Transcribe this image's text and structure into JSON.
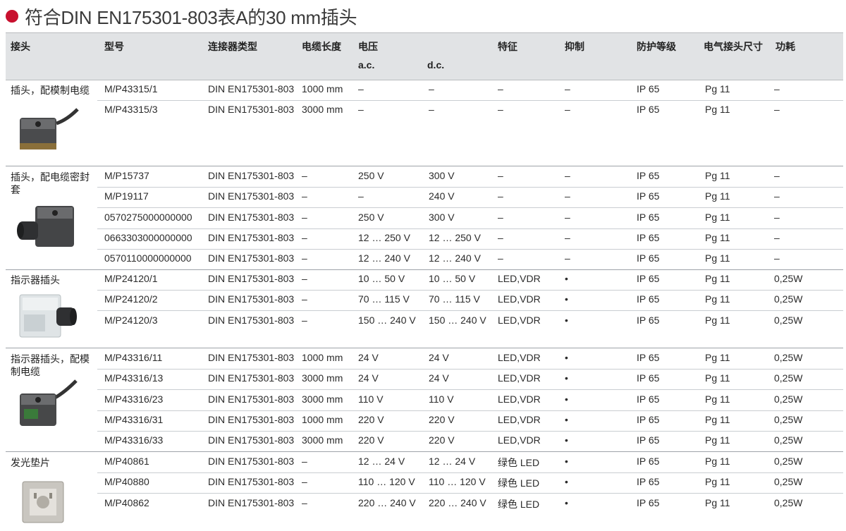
{
  "title": "符合DIN EN175301-803表A的30 mm插头",
  "accent": "#c8102e",
  "header": {
    "cols": [
      "接头",
      "型号",
      "连接器类型",
      "电缆长度",
      "电压",
      "特征",
      "抑制",
      "防护等级",
      "电气接头尺寸",
      "功耗"
    ],
    "sub": [
      "a.c.",
      "d.c."
    ]
  },
  "groups": [
    {
      "name": "插头，配模制电缆",
      "icon": "plug-with-cable-icon",
      "rows": [
        [
          "M/P43315/1",
          "DIN EN175301-803",
          "1000 mm",
          "–",
          "–",
          "–",
          "–",
          "IP 65",
          "Pg 11",
          "–"
        ],
        [
          "M/P43315/3",
          "DIN EN175301-803",
          "3000 mm",
          "–",
          "–",
          "–",
          "–",
          "IP 65",
          "Pg 11",
          "–"
        ]
      ]
    },
    {
      "name": "插头，配电缆密封套",
      "icon": "plug-cable-gland-icon",
      "rows": [
        [
          "M/P15737",
          "DIN EN175301-803",
          "–",
          "250 V",
          "300 V",
          "–",
          "–",
          "IP 65",
          "Pg 11",
          "–"
        ],
        [
          "M/P19117",
          "DIN EN175301-803",
          "–",
          "–",
          "240 V",
          "–",
          "–",
          "IP 65",
          "Pg 11",
          "–"
        ],
        [
          "0570275000000000",
          "DIN EN175301-803",
          "–",
          "250 V",
          "300 V",
          "–",
          "–",
          "IP 65",
          "Pg 11",
          "–"
        ],
        [
          "0663303000000000",
          "DIN EN175301-803",
          "–",
          "12 … 250 V",
          "12 … 250 V",
          "–",
          "–",
          "IP 65",
          "Pg 11",
          "–"
        ],
        [
          "0570110000000000",
          "DIN EN175301-803",
          "–",
          "12 … 240 V",
          "12 … 240 V",
          "–",
          "–",
          "IP 65",
          "Pg 11",
          "–"
        ]
      ]
    },
    {
      "name": "指示器插头",
      "icon": "indicator-plug-icon",
      "rows": [
        [
          "M/P24120/1",
          "DIN EN175301-803",
          "–",
          "10 … 50 V",
          "10 … 50 V",
          "LED,VDR",
          "•",
          "IP 65",
          "Pg 11",
          "0,25W"
        ],
        [
          "M/P24120/2",
          "DIN EN175301-803",
          "–",
          "70 … 115 V",
          "70 … 115 V",
          "LED,VDR",
          "•",
          "IP 65",
          "Pg 11",
          "0,25W"
        ],
        [
          "M/P24120/3",
          "DIN EN175301-803",
          "–",
          "150 … 240 V",
          "150 … 240 V",
          "LED,VDR",
          "•",
          "IP 65",
          "Pg 11",
          "0,25W"
        ]
      ]
    },
    {
      "name": "指示器插头，配模制电缆",
      "icon": "indicator-plug-cable-icon",
      "rows": [
        [
          "M/P43316/11",
          "DIN EN175301-803",
          "1000 mm",
          "24 V",
          "24 V",
          "LED,VDR",
          "•",
          "IP 65",
          "Pg 11",
          "0,25W"
        ],
        [
          "M/P43316/13",
          "DIN EN175301-803",
          "3000 mm",
          "24 V",
          "24 V",
          "LED,VDR",
          "•",
          "IP 65",
          "Pg 11",
          "0,25W"
        ],
        [
          "M/P43316/23",
          "DIN EN175301-803",
          "3000 mm",
          "110 V",
          "110 V",
          "LED,VDR",
          "•",
          "IP 65",
          "Pg 11",
          "0,25W"
        ],
        [
          "M/P43316/31",
          "DIN EN175301-803",
          "1000 mm",
          "220 V",
          "220 V",
          "LED,VDR",
          "•",
          "IP 65",
          "Pg 11",
          "0,25W"
        ],
        [
          "M/P43316/33",
          "DIN EN175301-803",
          "3000 mm",
          "220 V",
          "220 V",
          "LED,VDR",
          "•",
          "IP 65",
          "Pg 11",
          "0,25W"
        ]
      ]
    },
    {
      "name": "发光垫片",
      "icon": "illuminated-gasket-icon",
      "rows": [
        [
          "M/P40861",
          "DIN EN175301-803",
          "–",
          "12 … 24 V",
          "12 … 24 V",
          "绿色 LED",
          "•",
          "IP 65",
          "Pg 11",
          "0,25W"
        ],
        [
          "M/P40880",
          "DIN EN175301-803",
          "–",
          "110 … 120 V",
          "110 … 120 V",
          "绿色 LED",
          "•",
          "IP 65",
          "Pg 11",
          "0,25W"
        ],
        [
          "M/P40862",
          "DIN EN175301-803",
          "–",
          "220 … 240 V",
          "220 … 240 V",
          "绿色 LED",
          "•",
          "IP 65",
          "Pg 11",
          "0,25W"
        ]
      ]
    }
  ]
}
